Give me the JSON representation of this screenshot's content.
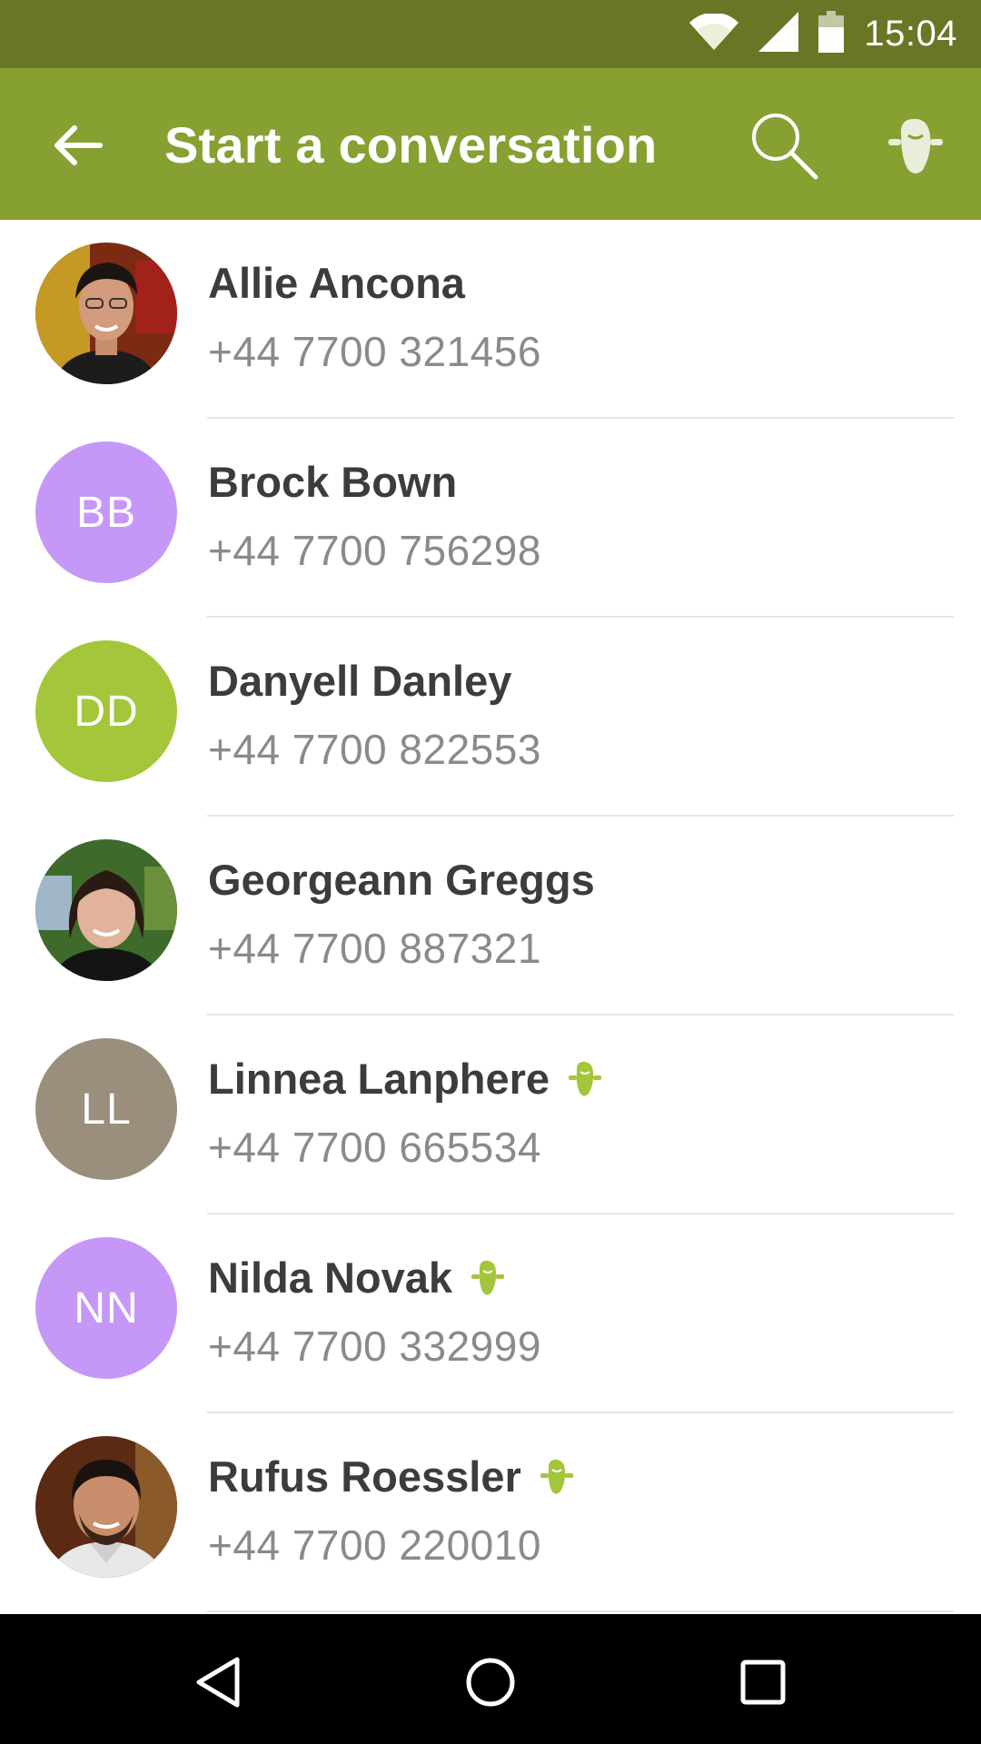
{
  "status_bar": {
    "time": "15:04",
    "icons": [
      "wifi-icon",
      "cell-signal-icon",
      "battery-icon"
    ]
  },
  "app_bar": {
    "title": "Start a conversation",
    "back_icon": "arrow-back-icon",
    "actions": [
      "search-icon",
      "mascot-icon"
    ],
    "color": "#86a032",
    "status_color": "#677725"
  },
  "contacts": [
    {
      "name": "Allie Ancona",
      "phone": "+44 7700 321456",
      "initials": "",
      "avatar_type": "photo",
      "badge": false
    },
    {
      "name": "Brock Bown",
      "phone": "+44 7700 756298",
      "initials": "BB",
      "avatar_color": "#c598f8",
      "badge": false
    },
    {
      "name": "Danyell Danley",
      "phone": "+44 7700 822553",
      "initials": "DD",
      "avatar_color": "#a5c53b",
      "badge": false
    },
    {
      "name": "Georgeann Greggs",
      "phone": "+44 7700 887321",
      "initials": "",
      "avatar_type": "photo",
      "badge": false
    },
    {
      "name": "Linnea Lanphere",
      "phone": "+44 7700 665534",
      "initials": "LL",
      "avatar_color": "#9a8e7d",
      "badge": true
    },
    {
      "name": "Nilda Novak",
      "phone": "+44 7700 332999",
      "initials": "NN",
      "avatar_color": "#c598f8",
      "badge": true
    },
    {
      "name": "Rufus Roessler",
      "phone": "+44 7700 220010",
      "initials": "",
      "avatar_type": "photo",
      "badge": true
    }
  ],
  "nav_bar": {
    "buttons": [
      "nav-back-icon",
      "nav-home-icon",
      "nav-recents-icon"
    ]
  },
  "colors": {
    "name_text": "#3c3c3c",
    "phone_text": "#8a8a8a",
    "badge_green": "#a5c53b"
  }
}
